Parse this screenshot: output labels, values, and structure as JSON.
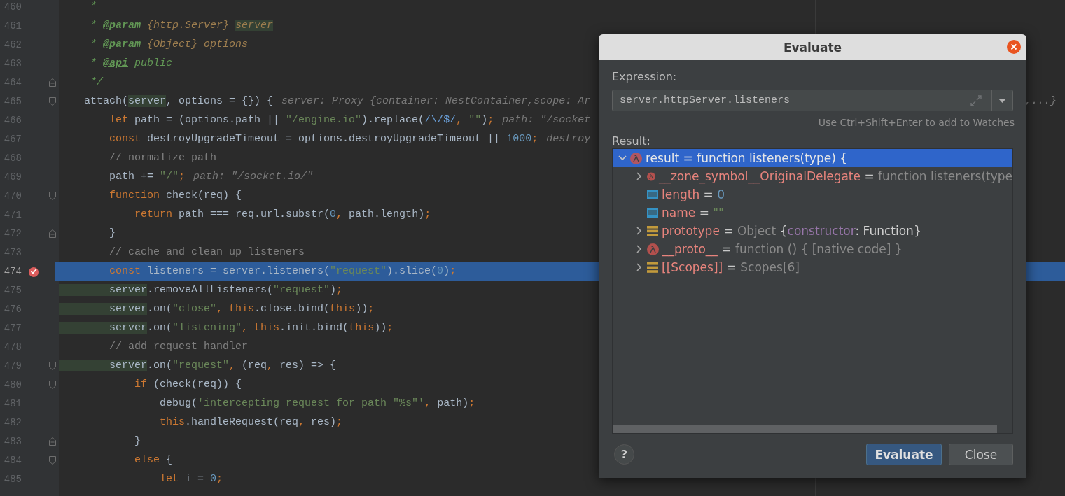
{
  "editor": {
    "lines": [
      {
        "number": "460",
        "current": false,
        "tokens": [
          {
            "kind": "doc",
            "text": "     *"
          }
        ]
      },
      {
        "number": "461",
        "current": false,
        "tokens": [
          {
            "kind": "doc",
            "text": "     * "
          },
          {
            "kind": "doctag",
            "text": "@param"
          },
          {
            "kind": "doctype",
            "text": " {http.Server} "
          },
          {
            "kind": "docref",
            "text": "server"
          }
        ]
      },
      {
        "number": "462",
        "current": false,
        "tokens": [
          {
            "kind": "doc",
            "text": "     * "
          },
          {
            "kind": "doctag",
            "text": "@param"
          },
          {
            "kind": "doctype",
            "text": " {Object} options"
          }
        ]
      },
      {
        "number": "463",
        "current": false,
        "tokens": [
          {
            "kind": "doc",
            "text": "     * "
          },
          {
            "kind": "doctag",
            "text": "@api"
          },
          {
            "kind": "doc",
            "text": " public"
          }
        ]
      },
      {
        "number": "464",
        "current": false,
        "fold_end": true,
        "tokens": [
          {
            "kind": "doc",
            "text": "     */"
          }
        ]
      },
      {
        "number": "465",
        "current": false,
        "fold_start": true,
        "tokens": [
          {
            "kind": "plain",
            "text": "    attach("
          },
          {
            "kind": "ref",
            "text": "server"
          },
          {
            "kind": "plain",
            "text": ", options = {}) {"
          }
        ],
        "hint": "server: Proxy {container: NestContainer,scope: Ar",
        "hint_tail": ",...}"
      },
      {
        "number": "466",
        "current": false,
        "tokens": [
          {
            "kind": "keyword",
            "text": "        let"
          },
          {
            "kind": "plain",
            "text": " path = (options.path || "
          },
          {
            "kind": "string",
            "text": "\"/engine.io\""
          },
          {
            "kind": "plain",
            "text": ").replace("
          },
          {
            "kind": "regex",
            "text": "/\\/$/"
          },
          {
            "kind": "keyword",
            "text": ", "
          },
          {
            "kind": "string",
            "text": "\"\""
          },
          {
            "kind": "plain",
            "text": ")"
          },
          {
            "kind": "keyword",
            "text": ";"
          }
        ],
        "hint": "path: \"/socket"
      },
      {
        "number": "467",
        "current": false,
        "tokens": [
          {
            "kind": "keyword",
            "text": "        const"
          },
          {
            "kind": "plain",
            "text": " destroyUpgradeTimeout = options.destroyUpgradeTimeout || "
          },
          {
            "kind": "number",
            "text": "1000"
          },
          {
            "kind": "keyword",
            "text": ";"
          }
        ],
        "hint": "destroy"
      },
      {
        "number": "468",
        "current": false,
        "tokens": [
          {
            "kind": "comment",
            "text": "        // normalize path"
          }
        ]
      },
      {
        "number": "469",
        "current": false,
        "tokens": [
          {
            "kind": "plain",
            "text": "        path += "
          },
          {
            "kind": "string",
            "text": "\"/\""
          },
          {
            "kind": "keyword",
            "text": ";"
          }
        ],
        "hint": "path: \"/socket.io/\""
      },
      {
        "number": "470",
        "current": false,
        "fold_start": true,
        "tokens": [
          {
            "kind": "keyword",
            "text": "        function"
          },
          {
            "kind": "plain",
            "text": " check(req) {"
          }
        ]
      },
      {
        "number": "471",
        "current": false,
        "tokens": [
          {
            "kind": "keyword",
            "text": "            return"
          },
          {
            "kind": "plain",
            "text": " path === req.url.substr("
          },
          {
            "kind": "number",
            "text": "0"
          },
          {
            "kind": "keyword",
            "text": ","
          },
          {
            "kind": "plain",
            "text": " path.length)"
          },
          {
            "kind": "keyword",
            "text": ";"
          }
        ]
      },
      {
        "number": "472",
        "current": false,
        "fold_end": true,
        "tokens": [
          {
            "kind": "plain",
            "text": "        }"
          }
        ]
      },
      {
        "number": "473",
        "current": false,
        "tokens": [
          {
            "kind": "comment",
            "text": "        // cache and clean up listeners"
          }
        ]
      },
      {
        "number": "474",
        "current": true,
        "breakpoint": true,
        "tokens": [
          {
            "kind": "keyword",
            "text": "        const"
          },
          {
            "kind": "plain",
            "text": " listeners = server.listeners("
          },
          {
            "kind": "string",
            "text": "\"request\""
          },
          {
            "kind": "plain",
            "text": ").slice("
          },
          {
            "kind": "number",
            "text": "0"
          },
          {
            "kind": "plain",
            "text": ")"
          },
          {
            "kind": "keyword",
            "text": ";"
          }
        ]
      },
      {
        "number": "475",
        "current": false,
        "tokens": [
          {
            "kind": "ref",
            "text": "        server"
          },
          {
            "kind": "plain",
            "text": ".removeAllListeners("
          },
          {
            "kind": "string",
            "text": "\"request\""
          },
          {
            "kind": "plain",
            "text": ")"
          },
          {
            "kind": "keyword",
            "text": ";"
          }
        ]
      },
      {
        "number": "476",
        "current": false,
        "tokens": [
          {
            "kind": "ref",
            "text": "        server"
          },
          {
            "kind": "plain",
            "text": ".on("
          },
          {
            "kind": "string",
            "text": "\"close\""
          },
          {
            "kind": "keyword",
            "text": ", this"
          },
          {
            "kind": "plain",
            "text": ".close.bind("
          },
          {
            "kind": "keyword",
            "text": "this"
          },
          {
            "kind": "plain",
            "text": "))"
          },
          {
            "kind": "keyword",
            "text": ";"
          }
        ]
      },
      {
        "number": "477",
        "current": false,
        "tokens": [
          {
            "kind": "ref",
            "text": "        server"
          },
          {
            "kind": "plain",
            "text": ".on("
          },
          {
            "kind": "string",
            "text": "\"listening\""
          },
          {
            "kind": "keyword",
            "text": ", this"
          },
          {
            "kind": "plain",
            "text": ".init.bind("
          },
          {
            "kind": "keyword",
            "text": "this"
          },
          {
            "kind": "plain",
            "text": "))"
          },
          {
            "kind": "keyword",
            "text": ";"
          }
        ]
      },
      {
        "number": "478",
        "current": false,
        "tokens": [
          {
            "kind": "comment",
            "text": "        // add request handler"
          }
        ]
      },
      {
        "number": "479",
        "current": false,
        "fold_start": true,
        "tokens": [
          {
            "kind": "ref",
            "text": "        server"
          },
          {
            "kind": "plain",
            "text": ".on("
          },
          {
            "kind": "string",
            "text": "\"request\""
          },
          {
            "kind": "keyword",
            "text": ","
          },
          {
            "kind": "plain",
            "text": " (req"
          },
          {
            "kind": "keyword",
            "text": ","
          },
          {
            "kind": "plain",
            "text": " res) => {"
          }
        ]
      },
      {
        "number": "480",
        "current": false,
        "fold_start": true,
        "tokens": [
          {
            "kind": "keyword",
            "text": "            if"
          },
          {
            "kind": "plain",
            "text": " (check(req)) {"
          }
        ]
      },
      {
        "number": "481",
        "current": false,
        "tokens": [
          {
            "kind": "plain",
            "text": "                debug("
          },
          {
            "kind": "string",
            "text": "'intercepting request for path \"%s\"'"
          },
          {
            "kind": "keyword",
            "text": ","
          },
          {
            "kind": "plain",
            "text": " path)"
          },
          {
            "kind": "keyword",
            "text": ";"
          }
        ]
      },
      {
        "number": "482",
        "current": false,
        "tokens": [
          {
            "kind": "keyword",
            "text": "                this"
          },
          {
            "kind": "plain",
            "text": ".handleRequest(req"
          },
          {
            "kind": "keyword",
            "text": ","
          },
          {
            "kind": "plain",
            "text": " res)"
          },
          {
            "kind": "keyword",
            "text": ";"
          }
        ]
      },
      {
        "number": "483",
        "current": false,
        "fold_end": true,
        "tokens": [
          {
            "kind": "plain",
            "text": "            }"
          }
        ]
      },
      {
        "number": "484",
        "current": false,
        "fold_start": true,
        "tokens": [
          {
            "kind": "keyword",
            "text": "            else"
          },
          {
            "kind": "plain",
            "text": " {"
          }
        ]
      },
      {
        "number": "485",
        "current": false,
        "tokens": [
          {
            "kind": "keyword",
            "text": "                let"
          },
          {
            "kind": "plain",
            "text": " i = "
          },
          {
            "kind": "number",
            "text": "0"
          },
          {
            "kind": "keyword",
            "text": ";"
          }
        ]
      }
    ]
  },
  "dialog": {
    "title": "Evaluate",
    "expression_label": "Expression:",
    "expression": "server.httpServer.listeners",
    "watch_hint": "Use Ctrl+Shift+Enter to add to Watches",
    "result_label": "Result:",
    "tree": [
      {
        "kind": "function",
        "expandable": true,
        "expanded": true,
        "selected": true,
        "name": "result",
        "operator": "=",
        "value": [
          {
            "kind": "type",
            "text": "function listeners(type) {"
          }
        ],
        "children": [
          {
            "kind": "function",
            "expandable": true,
            "expanded": false,
            "selected": false,
            "name": "__zone_symbol__OriginalDelegate",
            "operator": "=",
            "value": [
              {
                "kind": "type",
                "text": "function listeners(type"
              }
            ]
          },
          {
            "kind": "number",
            "expandable": false,
            "selected": false,
            "name": "length",
            "operator": "=",
            "value": [
              {
                "kind": "number",
                "text": "0"
              }
            ]
          },
          {
            "kind": "number",
            "expandable": false,
            "selected": false,
            "name": "name",
            "operator": "=",
            "value": [
              {
                "kind": "string",
                "text": "\"\""
              }
            ]
          },
          {
            "kind": "object",
            "expandable": true,
            "expanded": false,
            "selected": false,
            "name": "prototype",
            "operator": "=",
            "value": [
              {
                "kind": "type",
                "text": "Object "
              },
              {
                "kind": "light",
                "text": "{"
              },
              {
                "kind": "property",
                "text": "constructor"
              },
              {
                "kind": "light",
                "text": ": Function}"
              }
            ]
          },
          {
            "kind": "function",
            "expandable": true,
            "expanded": false,
            "selected": false,
            "name": "__proto__",
            "operator": "=",
            "value": [
              {
                "kind": "type",
                "text": "function () { [native code] }"
              }
            ]
          },
          {
            "kind": "object",
            "expandable": true,
            "expanded": false,
            "selected": false,
            "name": "[[Scopes]]",
            "operator": "=",
            "value": [
              {
                "kind": "type",
                "text": "Scopes[6]"
              }
            ]
          }
        ]
      }
    ],
    "help": "?",
    "buttons": [
      {
        "kind": "primary",
        "label": "Evaluate"
      },
      {
        "kind": "secondary",
        "label": "Close"
      }
    ]
  }
}
